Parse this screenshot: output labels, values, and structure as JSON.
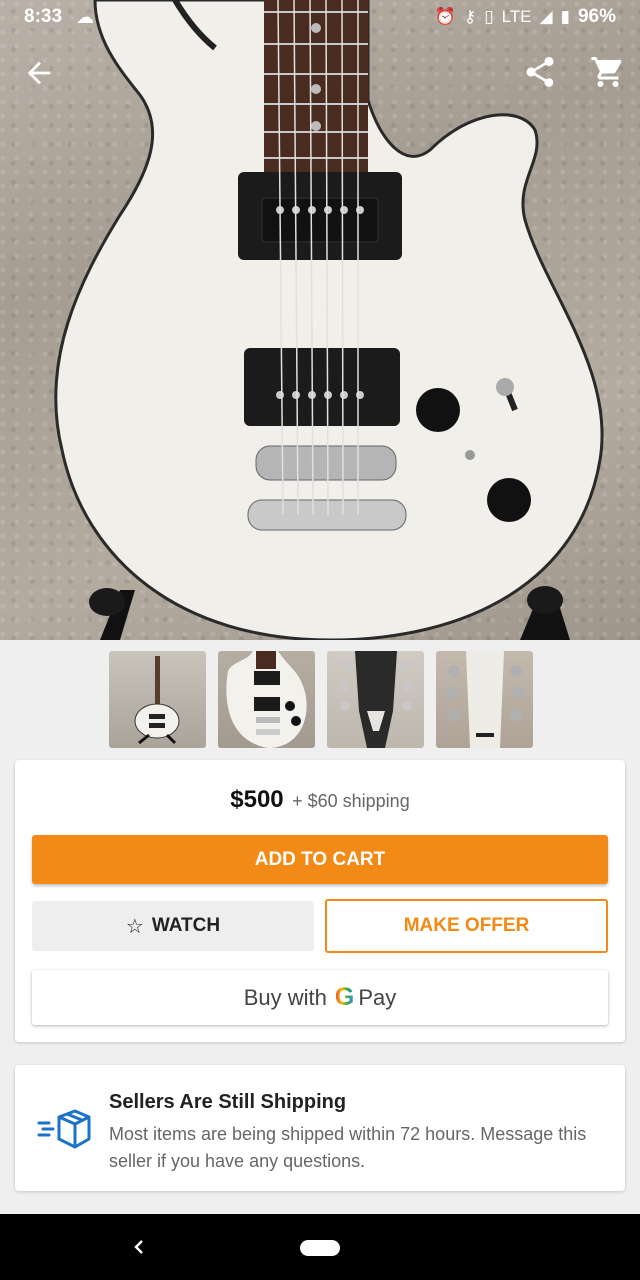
{
  "status_bar": {
    "time": "8:33",
    "network": "LTE",
    "battery": "96%"
  },
  "header_icons": [
    "back-arrow-icon",
    "share-icon",
    "cart-icon"
  ],
  "thumbnails": [
    {
      "name": "guitar-full-body"
    },
    {
      "name": "guitar-body-closeup"
    },
    {
      "name": "guitar-headstock-back"
    },
    {
      "name": "guitar-headstock-front"
    }
  ],
  "listing": {
    "price": "$500",
    "shipping": "+ $60 shipping",
    "add_to_cart_label": "ADD TO CART",
    "watch_label": "WATCH",
    "make_offer_label": "MAKE OFFER",
    "gpay_prefix": "Buy with",
    "gpay_g": "G",
    "gpay_suffix": "Pay"
  },
  "notice": {
    "title": "Sellers Are Still Shipping",
    "body": "Most items are being shipped within 72 hours. Message this seller if you have any questions."
  },
  "colors": {
    "accent": "#f28a15",
    "notice_icon": "#1a73c7"
  }
}
